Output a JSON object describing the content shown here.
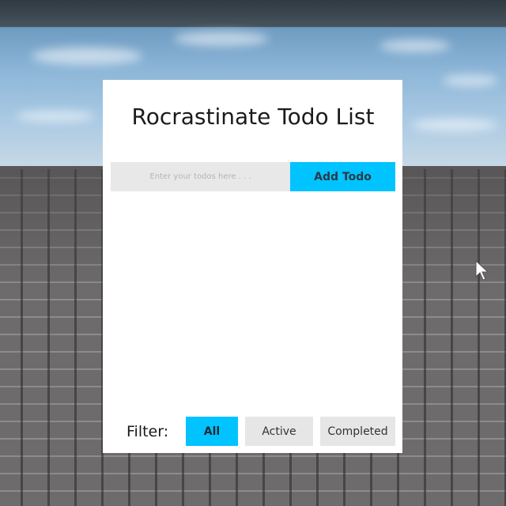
{
  "app": {
    "title": "Rocrastinate Todo List"
  },
  "input": {
    "placeholder": "Enter your todos here . . .",
    "value": ""
  },
  "add_button": {
    "label": "Add Todo"
  },
  "todos": [],
  "filter": {
    "label": "Filter:",
    "options": [
      "All",
      "Active",
      "Completed"
    ],
    "selected": "All"
  },
  "colors": {
    "accent": "#00c3ff",
    "panel": "#ffffff",
    "inactive_button": "#e6e6e6",
    "input_background": "#e8e8e8"
  },
  "icons": {
    "cursor": "arrow-cursor-icon"
  }
}
